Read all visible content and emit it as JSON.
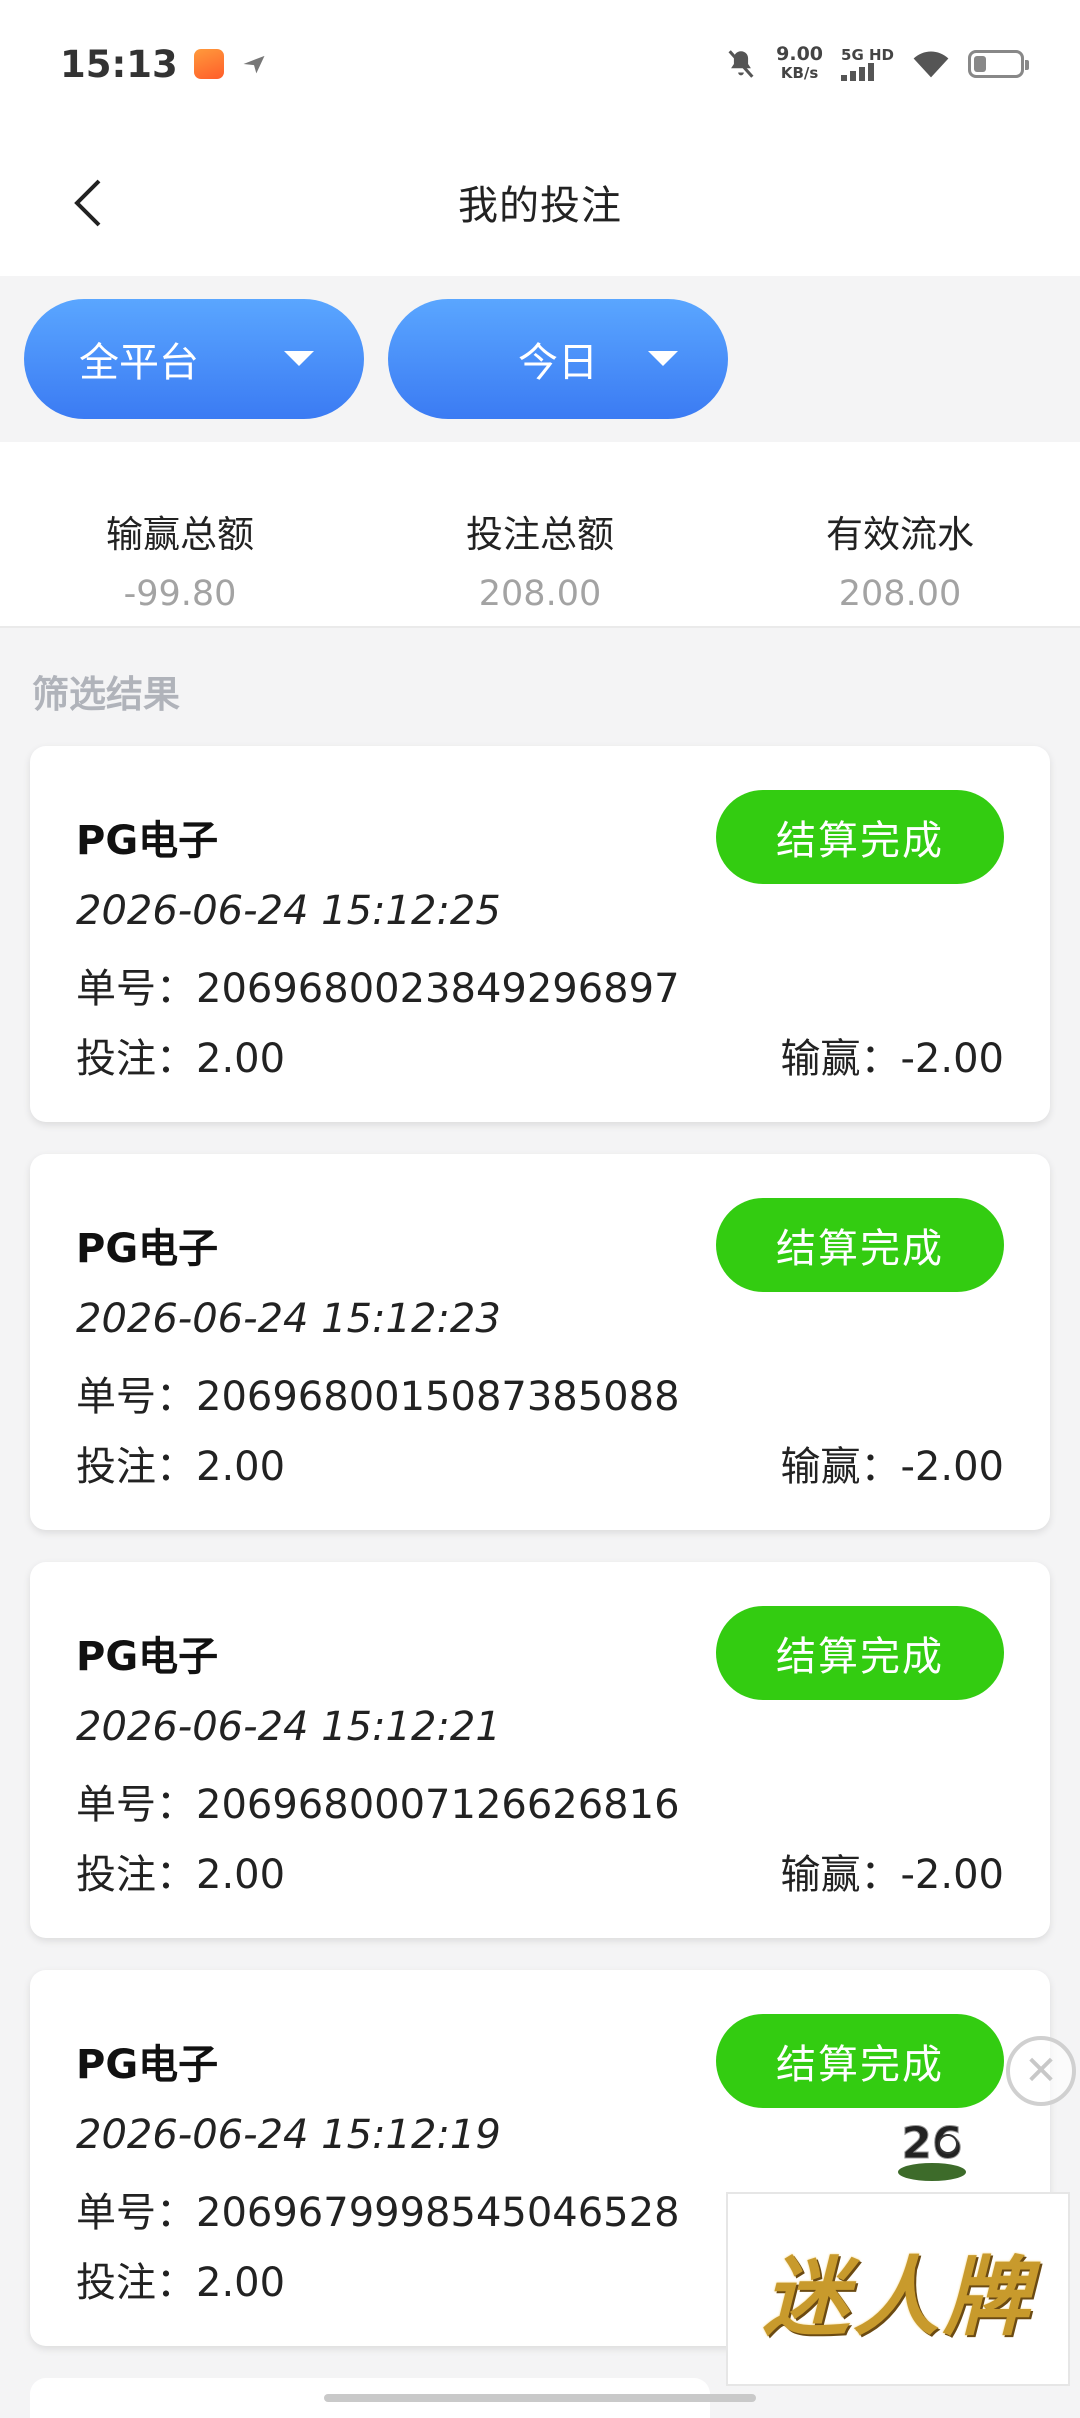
{
  "status_bar": {
    "time": "15:13",
    "speed_value": "9.00",
    "speed_unit": "KB/s",
    "network": "5G HD"
  },
  "nav": {
    "title": "我的投注"
  },
  "filters": {
    "platform": "全平台",
    "date": "今日"
  },
  "summary": {
    "items": [
      {
        "label": "输赢总额",
        "value": "-99.80"
      },
      {
        "label": "投注总额",
        "value": "208.00"
      },
      {
        "label": "有效流水",
        "value": "208.00"
      }
    ]
  },
  "section_title": "筛选结果",
  "records": [
    {
      "title": "PG电子",
      "status": "结算完成",
      "time": "2026-06-24 15:12:25",
      "order": "单号：2069680023849296897",
      "bet": "投注：2.00",
      "winloss": "输赢：-2.00"
    },
    {
      "title": "PG电子",
      "status": "结算完成",
      "time": "2026-06-24 15:12:23",
      "order": "单号：2069680015087385088",
      "bet": "投注：2.00",
      "winloss": "输赢：-2.00"
    },
    {
      "title": "PG电子",
      "status": "结算完成",
      "time": "2026-06-24 15:12:21",
      "order": "单号：2069680007126626816",
      "bet": "投注：2.00",
      "winloss": "输赢：-2.00"
    },
    {
      "title": "PG电子",
      "status": "结算完成",
      "time": "2026-06-24 15:12:19",
      "order": "单号：2069679998545046528",
      "bet": "投注：2.00",
      "winloss": ""
    }
  ],
  "ad": {
    "banner_text": "迷人牌",
    "close_symbol": "✕",
    "logo_text": "26"
  },
  "colors": {
    "accent_blue": "#3b7bf3",
    "success_green": "#33cc11",
    "muted_value": "#a3a3a3"
  }
}
